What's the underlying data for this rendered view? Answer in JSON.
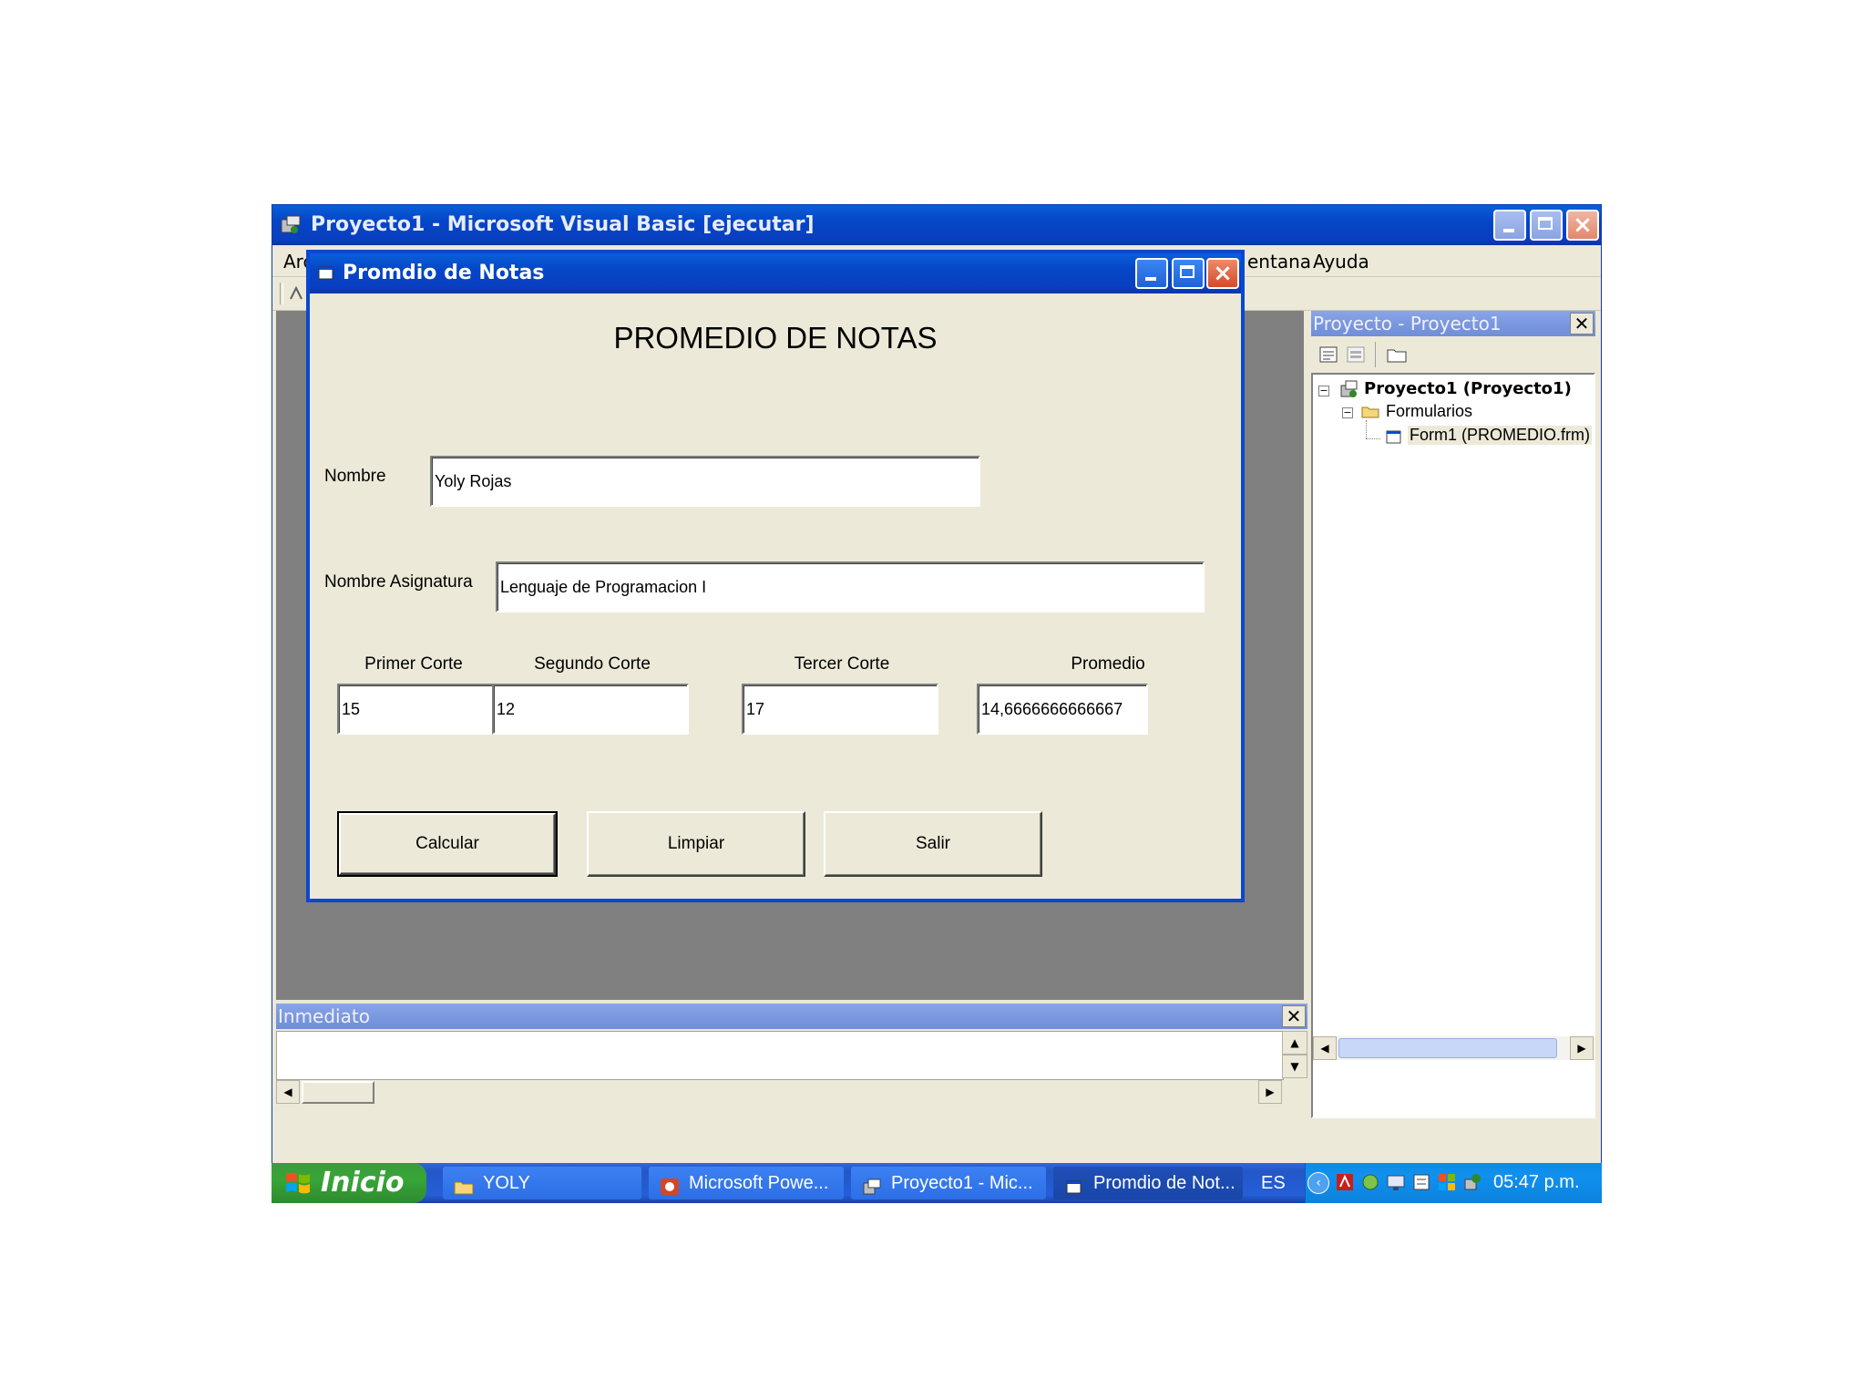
{
  "vb": {
    "title": "Proyecto1 - Microsoft Visual Basic [ejecutar]",
    "menu_left_fragment": "Arc",
    "menu_right": [
      "entana",
      "Ayuda"
    ]
  },
  "dialog": {
    "title": "Promdio de Notas",
    "heading": "PROMEDIO DE NOTAS",
    "nombre": {
      "label": "Nombre",
      "value": "Yoly Rojas"
    },
    "asignatura": {
      "label": "Nombre Asignatura",
      "value": "Lenguaje de Programacion I"
    },
    "grades": [
      {
        "label": "Primer Corte",
        "value": "15"
      },
      {
        "label": "Segundo Corte",
        "value": "12"
      },
      {
        "label": "Tercer Corte",
        "value": "17"
      },
      {
        "label": "Promedio",
        "value": "14,6666666666667"
      }
    ],
    "buttons": {
      "calcular": "Calcular",
      "limpiar": "Limpiar",
      "salir": "Salir"
    }
  },
  "project_pane": {
    "title": "Proyecto - Proyecto1",
    "tree": {
      "root": "Proyecto1 (Proyecto1)",
      "folder": "Formularios",
      "form": "Form1 (PROMEDIO.frm)"
    }
  },
  "immediate": {
    "title": "Inmediato"
  },
  "taskbar": {
    "start": "Inicio",
    "tasks": [
      {
        "label": "YOLY",
        "icon": "folder-icon"
      },
      {
        "label": "Microsoft Powe...",
        "icon": "powerpoint-icon"
      },
      {
        "label": "Proyecto1 - Mic...",
        "icon": "vb-icon"
      },
      {
        "label": "Promdio de Not...",
        "icon": "form-icon"
      }
    ],
    "language": "ES",
    "clock": "05:47 p.m."
  }
}
